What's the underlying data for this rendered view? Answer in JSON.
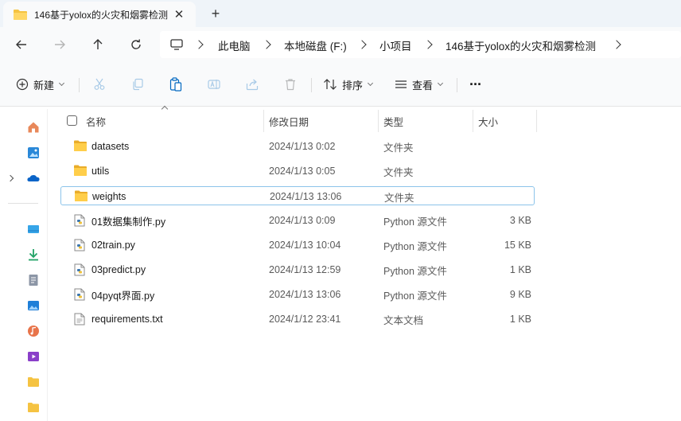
{
  "tab": {
    "title": "146基于yolox的火灾和烟雾检测",
    "close_label": "✕",
    "new_tab_label": "+"
  },
  "breadcrumb": [
    "此电脑",
    "本地磁盘 (F:)",
    "小项目",
    "146基于yolox的火灾和烟雾检测"
  ],
  "toolbar": {
    "new_label": "新建",
    "sort_label": "排序",
    "view_label": "查看",
    "more_label": "···"
  },
  "columns": {
    "name": "名称",
    "date": "修改日期",
    "type": "类型",
    "size": "大小"
  },
  "files": [
    {
      "name": "datasets",
      "date": "2024/1/13 0:02",
      "type": "文件夹",
      "size": "",
      "icon": "folder-icon"
    },
    {
      "name": "utils",
      "date": "2024/1/13 0:05",
      "type": "文件夹",
      "size": "",
      "icon": "folder-icon"
    },
    {
      "name": "weights",
      "date": "2024/1/13 13:06",
      "type": "文件夹",
      "size": "",
      "icon": "folder-icon",
      "selected": true
    },
    {
      "name": "01数据集制作.py",
      "date": "2024/1/13 0:09",
      "type": "Python 源文件",
      "size": "3 KB",
      "icon": "python-file-icon"
    },
    {
      "name": "02train.py",
      "date": "2024/1/13 10:04",
      "type": "Python 源文件",
      "size": "15 KB",
      "icon": "python-file-icon"
    },
    {
      "name": "03predict.py",
      "date": "2024/1/13 12:59",
      "type": "Python 源文件",
      "size": "1 KB",
      "icon": "python-file-icon"
    },
    {
      "name": "04pyqt界面.py",
      "date": "2024/1/13 13:06",
      "type": "Python 源文件",
      "size": "9 KB",
      "icon": "python-file-icon"
    },
    {
      "name": "requirements.txt",
      "date": "2024/1/12 23:41",
      "type": "文本文档",
      "size": "1 KB",
      "icon": "text-file-icon"
    }
  ],
  "nav_icons": [
    "home-icon",
    "gallery-icon",
    "onedrive-icon",
    "desktop-icon",
    "downloads-icon",
    "documents-icon",
    "pictures-icon",
    "music-icon",
    "videos-icon",
    "folder-icon",
    "folder-icon"
  ],
  "colors": {
    "folder": "#f5c342",
    "selection": "#8cc4ea",
    "accent": "#0067c0"
  }
}
